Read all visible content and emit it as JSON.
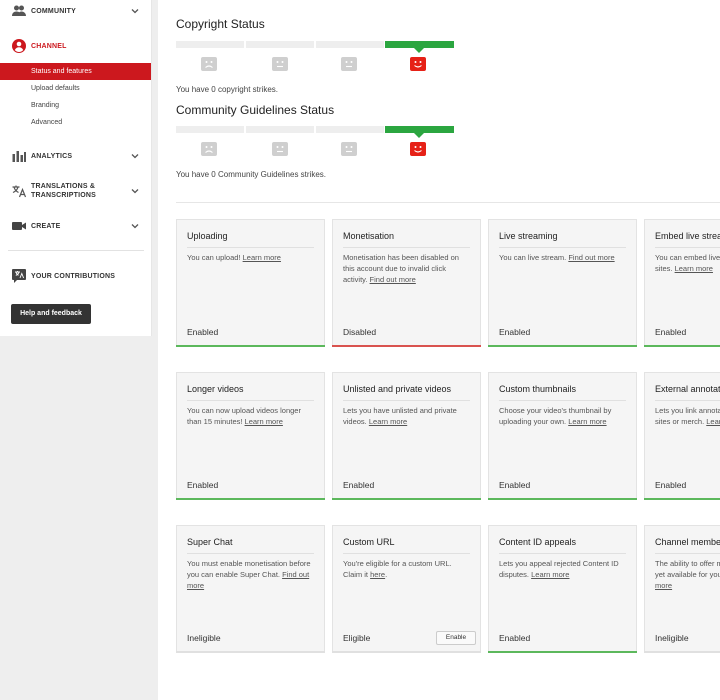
{
  "sidebar": {
    "community_label": "COMMUNITY",
    "channel_label": "CHANNEL",
    "channel_items": [
      "Status and features",
      "Upload defaults",
      "Branding",
      "Advanced"
    ],
    "analytics_label": "ANALYTICS",
    "translations_label": "TRANSLATIONS & TRANSCRIPTIONS",
    "create_label": "CREATE",
    "contributions_label": "YOUR CONTRIBUTIONS",
    "help_label": "Help and feedback"
  },
  "copyright": {
    "title": "Copyright Status",
    "text": "You have 0 copyright strikes."
  },
  "guidelines": {
    "title": "Community Guidelines Status",
    "text": "You have 0 Community Guidelines strikes."
  },
  "cards": [
    {
      "title": "Uploading",
      "desc": "You can upload! ",
      "link": "Learn more",
      "status": "Enabled",
      "bar": "green"
    },
    {
      "title": "Monetisation",
      "desc": "Monetisation has been disabled on this account due to invalid click activity. ",
      "link": "Find out more",
      "status": "Disabled",
      "bar": "red"
    },
    {
      "title": "Live streaming",
      "desc": "You can live stream. ",
      "link": "Find out more",
      "status": "Enabled",
      "bar": "green"
    },
    {
      "title": "Embed live streams",
      "desc": "You can embed live streams on other sites. ",
      "link": "Learn more",
      "status": "Enabled",
      "bar": "green"
    },
    {
      "title": "Longer videos",
      "desc": "You can now upload videos longer than 15 minutes! ",
      "link": "Learn more",
      "status": "Enabled",
      "bar": "green"
    },
    {
      "title": "Unlisted and private videos",
      "desc": "Lets you have unlisted and private videos. ",
      "link": "Learn more",
      "status": "Enabled",
      "bar": "green"
    },
    {
      "title": "Custom thumbnails",
      "desc": "Choose your video's thumbnail by uploading your own. ",
      "link": "Learn more",
      "status": "Enabled",
      "bar": "green"
    },
    {
      "title": "External annotations",
      "desc": "Lets you link annotations to external sites or merch. ",
      "link": "Learn more",
      "status": "Enabled",
      "bar": "green"
    },
    {
      "title": "Super Chat",
      "desc": "You must enable monetisation before you can enable Super Chat. ",
      "link": "Find out more",
      "status": "Ineligible",
      "bar": "none"
    },
    {
      "title": "Custom URL",
      "desc": "You're eligible for a custom URL. Claim it ",
      "link": "here",
      "tail": ".",
      "status": "Eligible",
      "bar": "none",
      "button": "Enable"
    },
    {
      "title": "Content ID appeals",
      "desc": "Lets you appeal rejected Content ID disputes. ",
      "link": "Learn more",
      "status": "Enabled",
      "bar": "green"
    },
    {
      "title": "Channel memberships",
      "desc": "The ability to offer memberships isn't yet available for your channel. ",
      "link": "Learn more",
      "status": "Ineligible",
      "bar": "none"
    }
  ],
  "colors": {
    "accent_red": "#cc181e",
    "status_green": "#5cb85c",
    "status_red": "#d9534f",
    "strike_green": "#2ba640"
  }
}
